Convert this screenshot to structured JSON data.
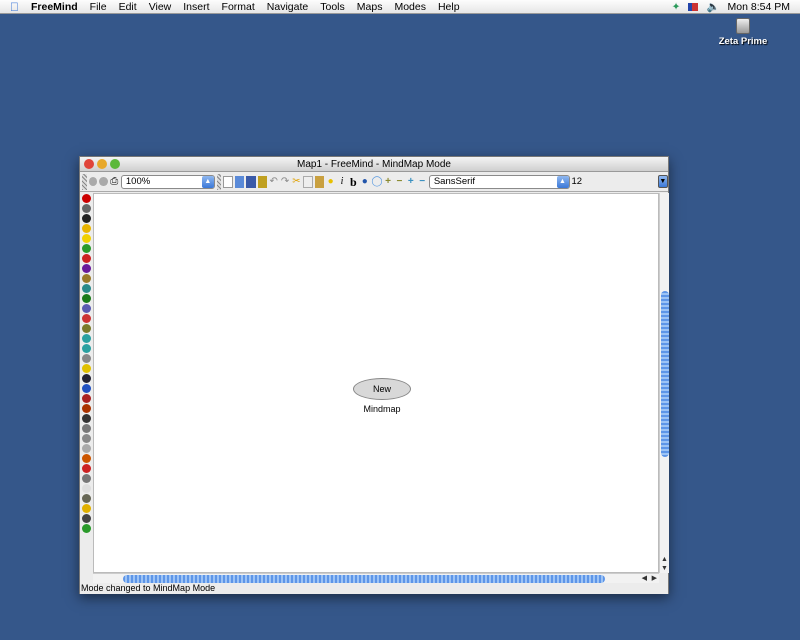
{
  "menubar": {
    "app": "FreeMind",
    "items": [
      "File",
      "Edit",
      "View",
      "Insert",
      "Format",
      "Navigate",
      "Tools",
      "Maps",
      "Modes",
      "Help"
    ],
    "clock": "Mon 8:54 PM"
  },
  "desktop": {
    "drive_label": "Zeta Prime"
  },
  "window": {
    "title": "Map1 - FreeMind - MindMap Mode",
    "zoom_value": "100%",
    "font_value": "SansSerif",
    "font_size": "12",
    "toolbar_icons": [
      "new-icon",
      "open-icon",
      "save-icon",
      "save-as-icon",
      "undo-icon",
      "redo-icon",
      "cut-icon",
      "copy-icon",
      "paste-icon",
      "bulb-icon",
      "italic-icon",
      "bold-icon",
      "cloud-icon",
      "edge-icon",
      "add-icon",
      "remove-icon",
      "add-child-icon",
      "remove-child-icon"
    ],
    "italic_label": "i",
    "bold_label": "b",
    "node_text": "New Mindmap",
    "status": "Mode changed to MindMap Mode",
    "left_icons": [
      "#cc0000",
      "#666",
      "#222",
      "#e8b400",
      "#f0d000",
      "#2a9a2a",
      "#cc2222",
      "#6a1a9a",
      "#9a7a2a",
      "#2a8a8a",
      "#1a7a1a",
      "#5a5ab0",
      "#cc3333",
      "#7a7a2a",
      "#2aa0a0",
      "#2aa0a0",
      "#888",
      "#e0c000",
      "#223",
      "#2050c0",
      "#aa2222",
      "#aa3300",
      "#333",
      "#777",
      "#888",
      "#aaa",
      "#cc5500",
      "#cc2222",
      "#777",
      "#ddd",
      "#665",
      "#e0b000",
      "#444",
      "#2a9a2a"
    ]
  }
}
